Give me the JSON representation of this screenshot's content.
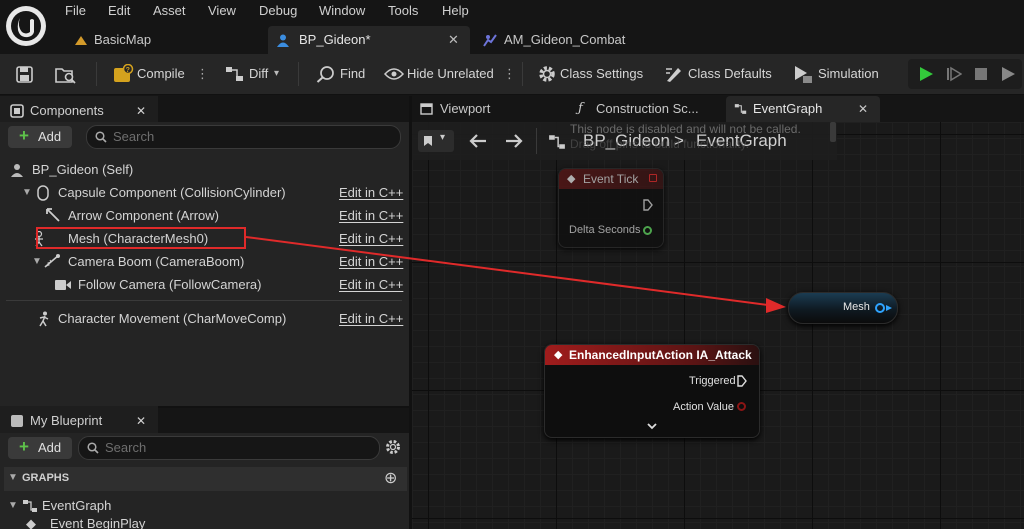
{
  "menu": [
    "File",
    "Edit",
    "Asset",
    "View",
    "Debug",
    "Window",
    "Tools",
    "Help"
  ],
  "tabs": [
    {
      "label": "BasicMap"
    },
    {
      "label": "BP_Gideon*"
    },
    {
      "label": "AM_Gideon_Combat"
    }
  ],
  "toolbar": {
    "compile": "Compile",
    "diff": "Diff",
    "find": "Find",
    "hide_unrelated": "Hide Unrelated",
    "class_settings": "Class Settings",
    "class_defaults": "Class Defaults",
    "simulation": "Simulation"
  },
  "components": {
    "title": "Components",
    "add": "Add",
    "search_placeholder": "Search",
    "self": "BP_Gideon (Self)",
    "items": [
      {
        "label": "Capsule Component (CollisionCylinder)",
        "edit": "Edit in C++"
      },
      {
        "label": "Arrow Component (Arrow)",
        "edit": "Edit in C++"
      },
      {
        "label": "Mesh (CharacterMesh0)",
        "edit": "Edit in C++"
      },
      {
        "label": "Camera Boom (CameraBoom)",
        "edit": "Edit in C++"
      },
      {
        "label": "Follow Camera (FollowCamera)",
        "edit": "Edit in C++"
      },
      {
        "label": "Character Movement (CharMoveComp)",
        "edit": "Edit in C++"
      }
    ]
  },
  "my_blueprint": {
    "title": "My Blueprint",
    "add": "Add",
    "search_placeholder": "Search",
    "graphs_header": "GRAPHS",
    "event_graph": "EventGraph",
    "begin_play": "Event BeginPlay"
  },
  "graph_tabs": [
    {
      "label": "Viewport"
    },
    {
      "label": "Construction Sc..."
    },
    {
      "label": "EventGraph"
    }
  ],
  "graph": {
    "breadcrumb_root": "BP_Gideon",
    "breadcrumb_sep": ">",
    "breadcrumb_leaf": "EventGraph",
    "disabled_note_1": "This node is disabled and will not be called.",
    "disabled_note_2": "Drag off pins to build functionality."
  },
  "nodes": {
    "event_tick": {
      "title": "Event Tick",
      "pin": "Delta Seconds"
    },
    "mesh": {
      "label": "Mesh"
    },
    "input_action": {
      "title": "EnhancedInputAction IA_Attack",
      "pin1": "Triggered",
      "pin2": "Action Value"
    }
  },
  "colors": {
    "annotation_red": "#e02a2a",
    "event_red": "#8b1a1a",
    "object_blue": "#2fa4ff",
    "play_green": "#33c93b"
  }
}
